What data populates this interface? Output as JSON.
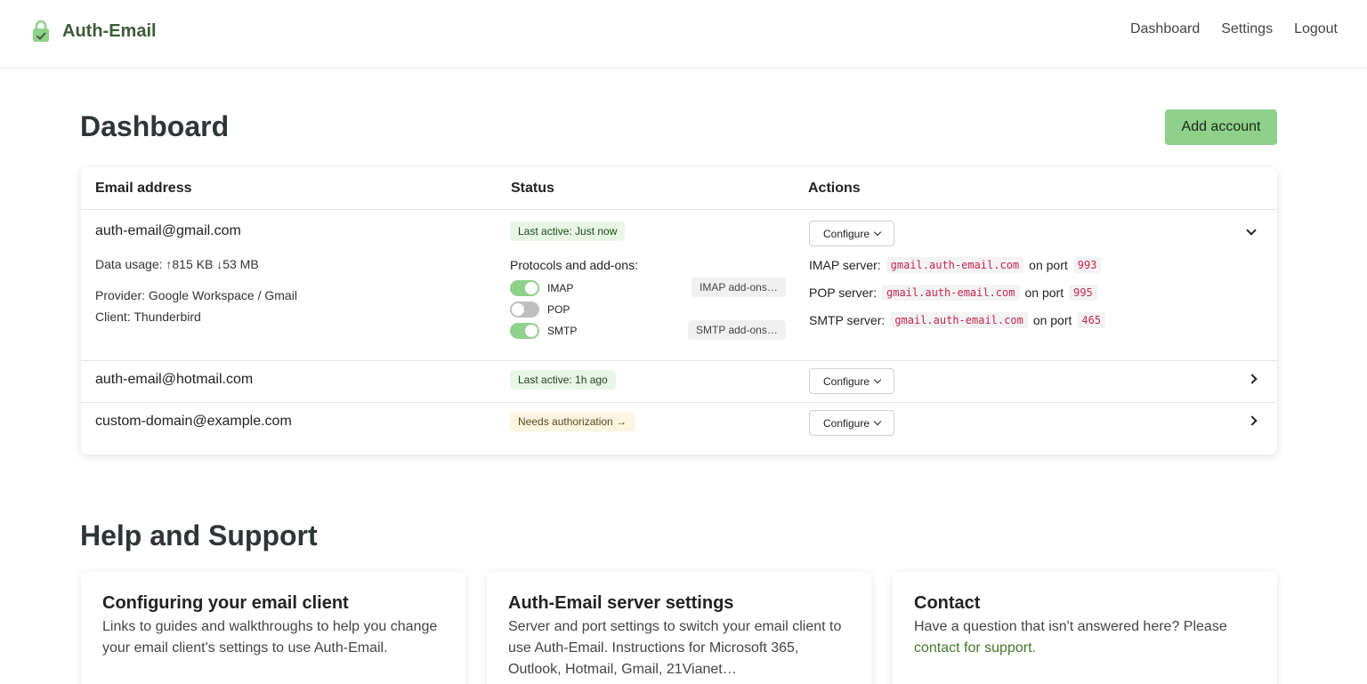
{
  "navbar": {
    "brand": "Auth-Email",
    "links": [
      "Dashboard",
      "Settings",
      "Logout"
    ]
  },
  "dashboard": {
    "title": "Dashboard",
    "add_button": "Add account",
    "columns": [
      "Email address",
      "Status",
      "Actions"
    ],
    "rows": [
      {
        "email": "auth-email@gmail.com",
        "data_usage": "Data usage: ↑815 KB ↓53 MB",
        "provider": "Provider: Google Workspace / Gmail",
        "client": "Client: Thunderbird",
        "status": "Last active: Just now",
        "protocols_title": "Protocols and add-ons:",
        "protocols": [
          {
            "name": "IMAP",
            "enabled": true,
            "addon": "IMAP add-ons…"
          },
          {
            "name": "POP",
            "enabled": false,
            "addon": ""
          },
          {
            "name": "SMTP",
            "enabled": true,
            "addon": "SMTP add-ons…"
          }
        ],
        "configure": "Configure",
        "servers": [
          {
            "label": "IMAP server:",
            "host": "gmail.auth-email.com",
            "on_port": "on port",
            "port": "993"
          },
          {
            "label": "POP server:",
            "host": "gmail.auth-email.com",
            "on_port": "on port",
            "port": "995"
          },
          {
            "label": "SMTP server:",
            "host": "gmail.auth-email.com",
            "on_port": "on port",
            "port": "465"
          }
        ]
      },
      {
        "email": "auth-email@hotmail.com",
        "status": "Last active: 1h ago",
        "configure": "Configure"
      },
      {
        "email": "custom-domain@example.com",
        "status": "Needs authorization →",
        "configure": "Configure"
      }
    ]
  },
  "help": {
    "title": "Help and Support",
    "cards": [
      {
        "title": "Configuring your email client",
        "text": "Links to guides and walkthroughs to help you change your email client's settings to use Auth-Email."
      },
      {
        "title": "Auth-Email server settings",
        "text": "Server and port settings to switch your email client to use Auth-Email. Instructions for Microsoft 365, Outlook, Hotmail, Gmail, 21Vianet…"
      },
      {
        "title": "Contact",
        "text": "Have a question that isn't answered here? Please",
        "link": "contact for support."
      }
    ]
  },
  "colors": {
    "accent": "#8fd08a",
    "brand_text": "#3f5a3a",
    "link": "#3e7a2b",
    "code": "#c7254e"
  },
  "icons": {
    "brand": "lock-check-icon",
    "row_expanded": "chevron-down-icon",
    "row_collapsed": "chevron-right-icon",
    "configure_dropdown": "chevron-down-icon"
  }
}
